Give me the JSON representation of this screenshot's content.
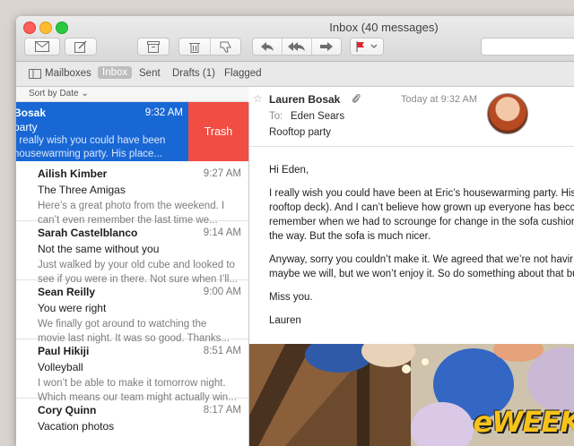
{
  "window": {
    "title": "Inbox (40 messages)"
  },
  "toolbar": {
    "buttons": [
      "get-mail",
      "compose",
      "archive",
      "delete",
      "junk",
      "reply",
      "reply-all",
      "forward",
      "flag"
    ]
  },
  "favorites": {
    "mailboxes": "Mailboxes",
    "inbox": "Inbox",
    "sent": "Sent",
    "drafts": "Drafts (1)",
    "flagged": "Flagged"
  },
  "sort": {
    "label": "Sort by Date"
  },
  "messages": [
    {
      "sender": "Bosak",
      "time": "9:32 AM",
      "subject": "party",
      "preview1": "I really wish you could have been",
      "preview2": "housewarming party. His place...",
      "swipe_action": "Trash"
    },
    {
      "sender": "Ailish Kimber",
      "time": "9:27 AM",
      "subject": "The Three Amigas",
      "preview1": "Here’s a great photo from the weekend. I",
      "preview2": "can’t even remember the last time we..."
    },
    {
      "sender": "Sarah Castelblanco",
      "time": "9:14 AM",
      "subject": "Not the same without you",
      "preview1": "Just walked by your old cube and looked to",
      "preview2": "see if you were in there. Not sure when I’ll..."
    },
    {
      "sender": "Sean Reilly",
      "time": "9:00 AM",
      "subject": "You were right",
      "preview1": "We finally got around to watching the",
      "preview2": "movie last night. It was so good. Thanks..."
    },
    {
      "sender": "Paul Hikiji",
      "time": "8:51 AM",
      "subject": "Volleyball",
      "preview1": "I won’t be able to make it tomorrow night.",
      "preview2": "Which means our team might actually win..."
    },
    {
      "sender": "Cory Quinn",
      "time": "8:17 AM",
      "subject": "Vacation photos",
      "preview1": "",
      "preview2": ""
    }
  ],
  "reader": {
    "from": "Lauren Bosak",
    "date": "Today at 9:32 AM",
    "to_label": "To:",
    "to": "Eden Sears",
    "subject": "Rooftop party",
    "greeting": "Hi Eden,",
    "p1_l1": "I really wish you could have been at Eric’s housewarming party. His",
    "p1_l2": "rooftop deck). And I can’t believe how grown up everyone has becc",
    "p1_l3": "remember when we had to scrounge for change in the sofa cushion",
    "p1_l4": "the way. But the sofa is much nicer.",
    "p2_l1": "Anyway, sorry you couldn’t make it. We agreed that we’re not havir",
    "p2_l2": "maybe we will, but we won’t enjoy it. So do something about that bu",
    "p3": "Miss you.",
    "sign": "Lauren"
  },
  "watermark": {
    "text": "eWEEK"
  }
}
